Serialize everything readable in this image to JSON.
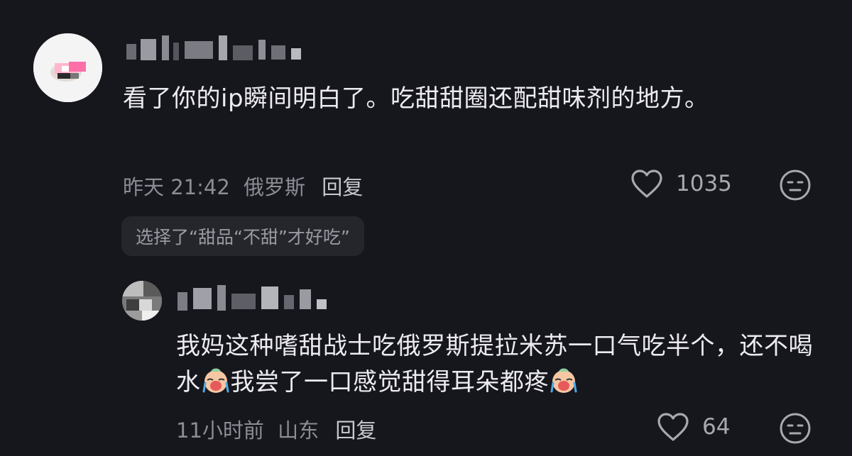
{
  "comment": {
    "text": "看了你的ip瞬间明白了。吃甜甜圈还配甜味剂的地方。",
    "time": "昨天 21:42",
    "location": "俄罗斯",
    "reply_label": "回复",
    "likes": "1035",
    "icons": {
      "like": "heart-outline-icon",
      "dislike": "neutral-face-icon"
    }
  },
  "suggestion": {
    "text": "选择了“甜品“不甜”才好吃”"
  },
  "reply": {
    "text_part1": "我妈这种嗜甜战士吃俄罗斯提拉米苏一口气吃半个，还不喝水",
    "text_part2": "我尝了一口感觉甜得耳朵都疼",
    "time": "11小时前",
    "location": "山东",
    "reply_label": "回复",
    "likes": "64",
    "icons": {
      "emoji": "crying-baby-emoji",
      "like": "heart-outline-icon",
      "dislike": "neutral-face-icon"
    }
  }
}
